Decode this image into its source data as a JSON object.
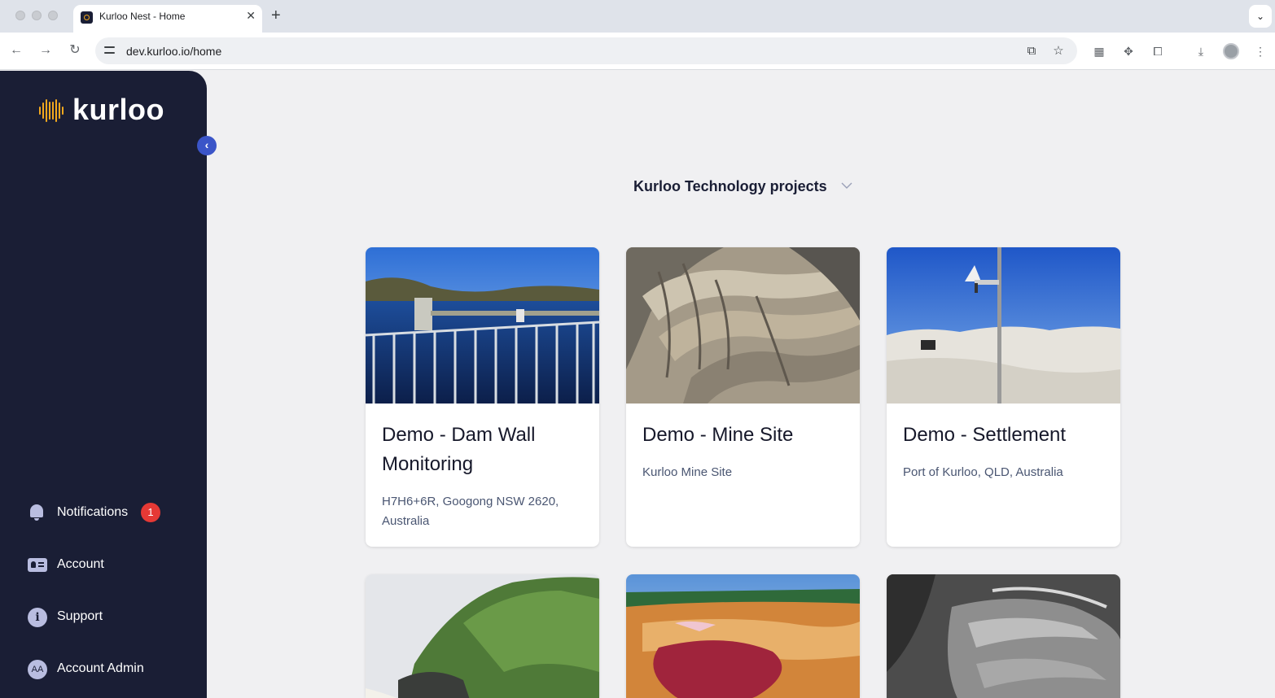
{
  "browser": {
    "tab_title": "Kurloo Nest - Home",
    "url": "dev.kurloo.io/home"
  },
  "sidebar": {
    "logo_text": "kurloo",
    "notifications": {
      "label": "Notifications",
      "count": "1"
    },
    "account": {
      "label": "Account"
    },
    "support": {
      "label": "Support"
    },
    "admin": {
      "label": "Account Admin",
      "initials": "AA"
    }
  },
  "main": {
    "org_selector": "Kurloo Technology projects",
    "projects": [
      {
        "title": "Demo - Dam Wall Monitoring",
        "location": "H7H6+6R, Googong NSW 2620, Australia"
      },
      {
        "title": "Demo - Mine Site",
        "location": "Kurloo Mine Site"
      },
      {
        "title": "Demo - Settlement",
        "location": "Port of Kurloo, QLD, Australia"
      },
      {
        "title": "",
        "location": ""
      },
      {
        "title": "",
        "location": ""
      },
      {
        "title": "",
        "location": ""
      }
    ]
  },
  "colors": {
    "sidebar_bg": "#1a1e35",
    "accent_orange": "#f2a81e",
    "collapse_blue": "#3b55c8",
    "badge_red": "#e53935"
  }
}
